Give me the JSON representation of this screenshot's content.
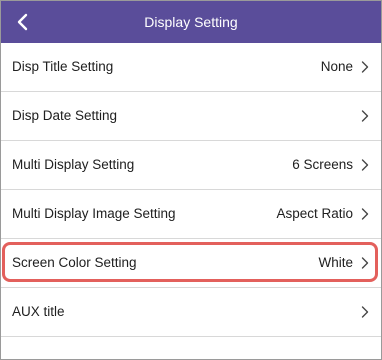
{
  "header": {
    "title": "Display Setting",
    "back_icon": "chevron-left-icon"
  },
  "colors": {
    "header_bg": "#5a4d9a",
    "highlight": "#e3605c",
    "divider": "#d8d8d8"
  },
  "settings": [
    {
      "label": "Disp Title Setting",
      "value": "None"
    },
    {
      "label": "Disp Date Setting",
      "value": ""
    },
    {
      "label": "Multi Display Setting",
      "value": "6 Screens"
    },
    {
      "label": "Multi Display Image Setting",
      "value": "Aspect Ratio"
    },
    {
      "label": "Screen Color Setting",
      "value": "White",
      "highlighted": true
    },
    {
      "label": "AUX title",
      "value": ""
    }
  ]
}
